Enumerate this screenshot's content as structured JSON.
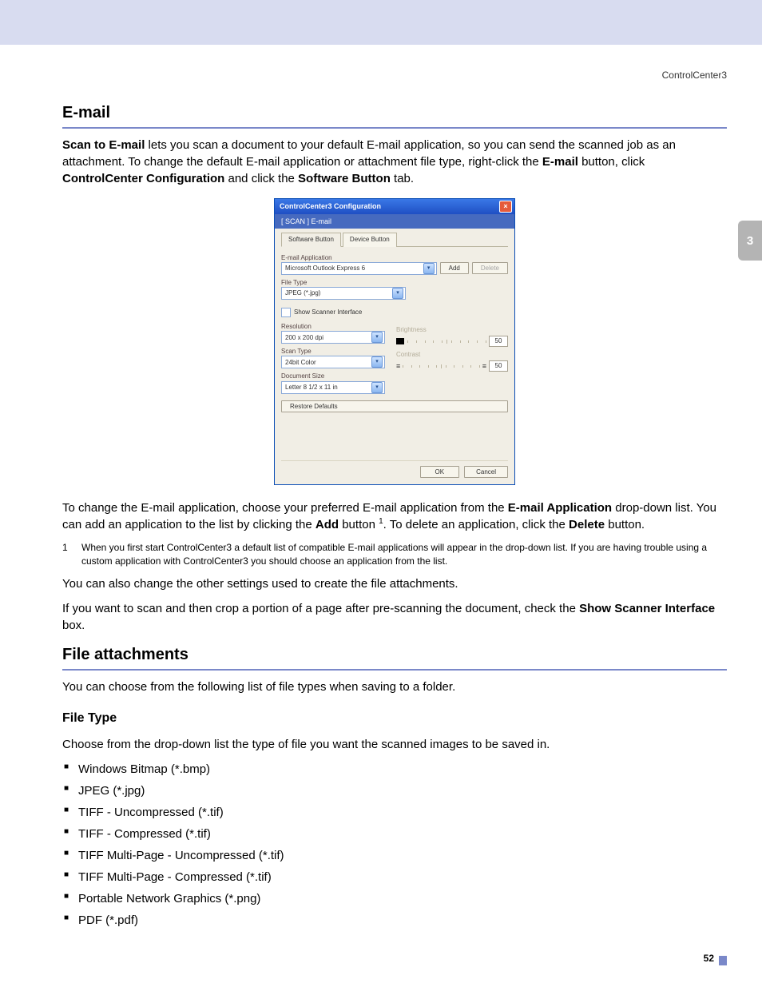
{
  "running_header": "ControlCenter3",
  "chapter_tab": "3",
  "page_number": "52",
  "section_email": {
    "heading": "E-mail",
    "p1a": "Scan to E-mail",
    "p1b": " lets you scan a document to your default E-mail application, so you can send the scanned job as an attachment. To change the default E-mail application or attachment file type, right-click the ",
    "p1c": "E-mail",
    "p1d": " button, click ",
    "p1e": "ControlCenter Configuration",
    "p1f": " and click the ",
    "p1g": "Software Button",
    "p1h": " tab.",
    "p2a": "To change the E-mail application, choose your preferred E-mail application from the ",
    "p2b": "E-mail Application",
    "p2c": " drop-down list. You can add an application to the list by clicking the ",
    "p2d": "Add",
    "p2e": " button ",
    "p2f": ". To delete an application, click the ",
    "p2g": "Delete",
    "p2h": " button.",
    "fn_num": "1",
    "fn_text": "When you first start ControlCenter3 a default list of compatible E-mail applications will appear in the drop-down list. If you are having trouble using a custom application with ControlCenter3 you should choose an application from the list.",
    "p3": "You can also change the other settings used to create the file attachments.",
    "p4a": "If you want to scan and then crop a portion of a page after pre-scanning the document, check the ",
    "p4b": "Show Scanner Interface",
    "p4c": " box."
  },
  "section_attach": {
    "heading": "File attachments",
    "intro": "You can choose from the following list of file types when saving to a folder.",
    "subheading": "File Type",
    "sub_intro": "Choose from the drop-down list the type of file you want the scanned images to be saved in.",
    "types": [
      "Windows Bitmap (*.bmp)",
      "JPEG (*.jpg)",
      "TIFF - Uncompressed (*.tif)",
      "TIFF - Compressed (*.tif)",
      "TIFF Multi-Page - Uncompressed (*.tif)",
      "TIFF Multi-Page - Compressed (*.tif)",
      "Portable Network Graphics (*.png)",
      "PDF (*.pdf)"
    ]
  },
  "dialog": {
    "title": "ControlCenter3 Configuration",
    "breadcrumb": "[  SCAN  ]  E-mail",
    "tab_software": "Software Button",
    "tab_device": "Device Button",
    "lbl_email_app": "E-mail Application",
    "val_email_app": "Microsoft Outlook Express 6",
    "btn_add": "Add",
    "btn_delete": "Delete",
    "lbl_file_type": "File Type",
    "val_file_type": "JPEG (*.jpg)",
    "chk_scanner_iface": "Show Scanner Interface",
    "lbl_resolution": "Resolution",
    "val_resolution": "200 x 200 dpi",
    "lbl_scan_type": "Scan Type",
    "val_scan_type": "24bit Color",
    "lbl_doc_size": "Document Size",
    "val_doc_size": "Letter 8 1/2 x 11 in",
    "lbl_brightness": "Brightness",
    "val_brightness": "50",
    "lbl_contrast": "Contrast",
    "val_contrast": "50",
    "btn_restore": "Restore Defaults",
    "btn_ok": "OK",
    "btn_cancel": "Cancel"
  }
}
